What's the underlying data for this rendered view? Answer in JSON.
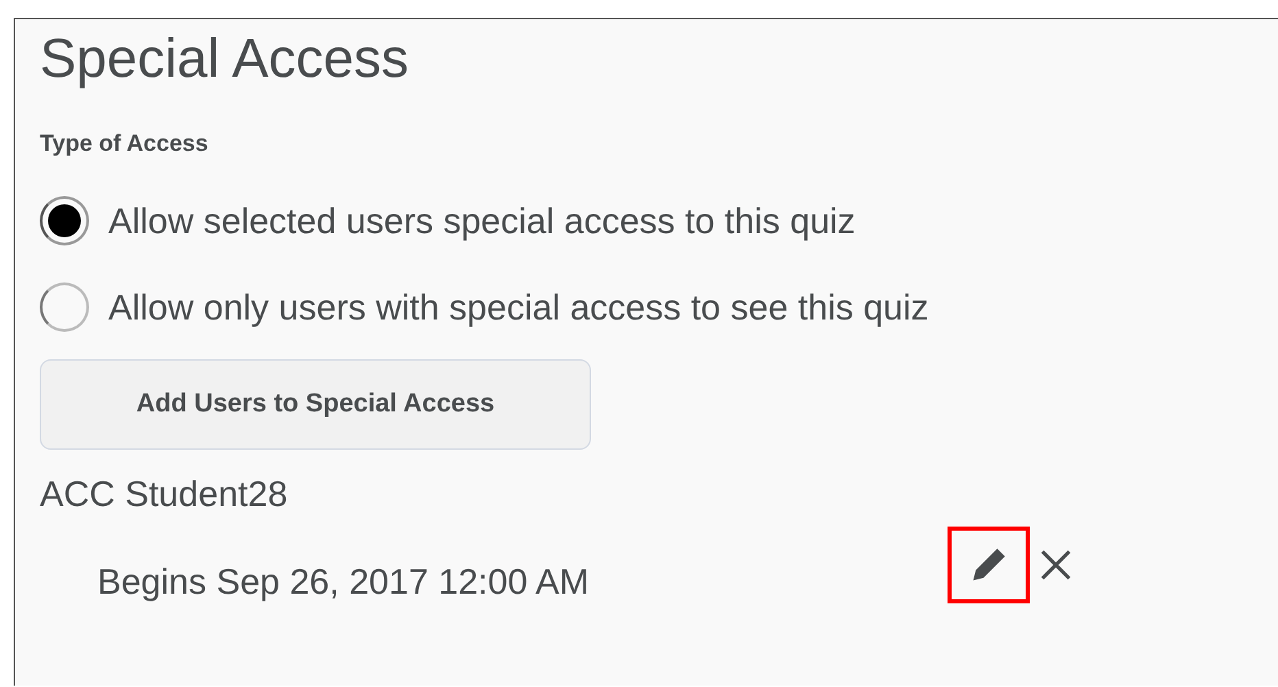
{
  "title": "Special Access",
  "type_label": "Type of Access",
  "options": [
    {
      "label": "Allow selected users special access to this quiz",
      "selected": true
    },
    {
      "label": "Allow only users with special access to see this quiz",
      "selected": false
    }
  ],
  "add_button": "Add Users to Special Access",
  "users": [
    {
      "name": "ACC Student28",
      "detail": "Begins Sep 26, 2017 12:00 AM",
      "edit_highlighted": true
    }
  ]
}
